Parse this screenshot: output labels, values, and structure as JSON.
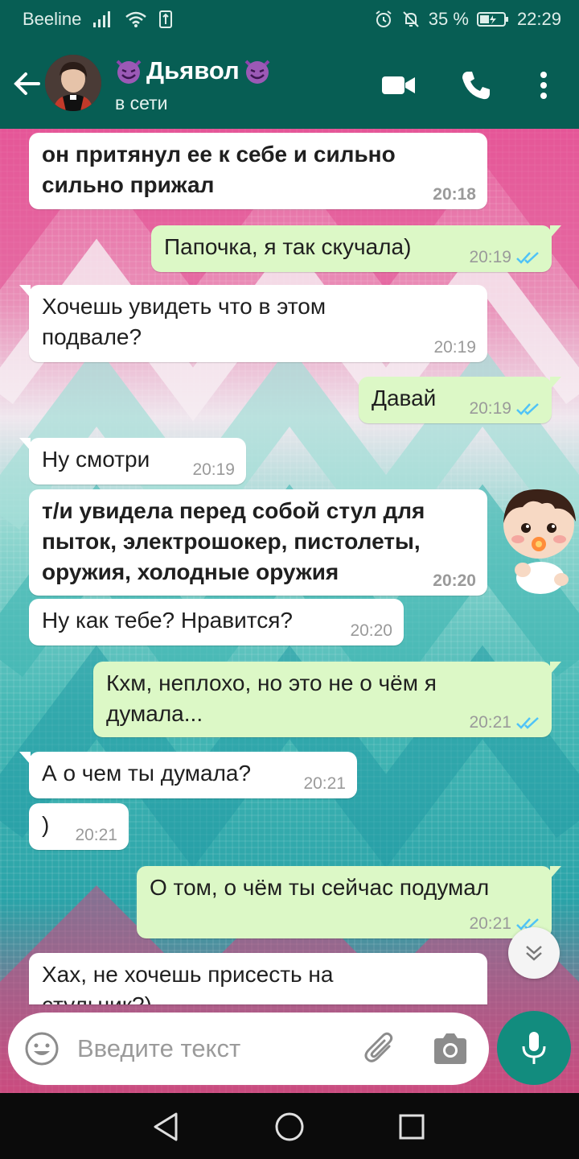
{
  "status_bar": {
    "carrier": "Beeline",
    "battery": "35 %",
    "time": "22:29"
  },
  "header": {
    "contact_name": "Дьявол",
    "contact_status": "в сети",
    "icons": [
      "back-arrow-icon",
      "video-call-icon",
      "phone-icon",
      "more-vert-icon"
    ]
  },
  "messages": [
    {
      "dir": "in",
      "bold": true,
      "text": "он притянул ее к себе и сильно сильно прижал",
      "time": "20:18"
    },
    {
      "dir": "out",
      "bold": false,
      "text": "Папочка, я так скучала)",
      "time": "20:19"
    },
    {
      "dir": "in",
      "bold": false,
      "text": "Хочешь увидеть что в этом подвале?",
      "time": "20:19"
    },
    {
      "dir": "out",
      "bold": false,
      "text": "Давай",
      "time": "20:19"
    },
    {
      "dir": "in",
      "bold": false,
      "text": "Ну смотри",
      "time": "20:19"
    },
    {
      "dir": "in",
      "bold": true,
      "text": "т/и увидела перед собой стул для пыток, электрошокер, пистолеты, оружия, холодные оружия",
      "time": "20:20"
    },
    {
      "dir": "in",
      "bold": false,
      "text": "Ну как тебе? Нравится?",
      "time": "20:20"
    },
    {
      "dir": "out",
      "bold": false,
      "text": "Кхм, неплохо, но это не о чём я думала...",
      "time": "20:21"
    },
    {
      "dir": "in",
      "bold": false,
      "text": "А о чем ты думала?",
      "time": "20:21"
    },
    {
      "dir": "in",
      "bold": false,
      "text": ")",
      "time": "20:21"
    },
    {
      "dir": "out",
      "bold": false,
      "text": "О том, о чём ты сейчас подумал",
      "time": "20:21"
    },
    {
      "dir": "in",
      "bold": false,
      "text": "Хах, не хочешь присесть на стульчик?)",
      "time": ""
    }
  ],
  "composer": {
    "placeholder": "Введите текст"
  },
  "colors": {
    "header": "#075e54",
    "incoming": "#ffffff",
    "outgoing": "#dcf8c6",
    "read_ticks": "#4fc3f7",
    "mic_button": "#128c7e"
  }
}
